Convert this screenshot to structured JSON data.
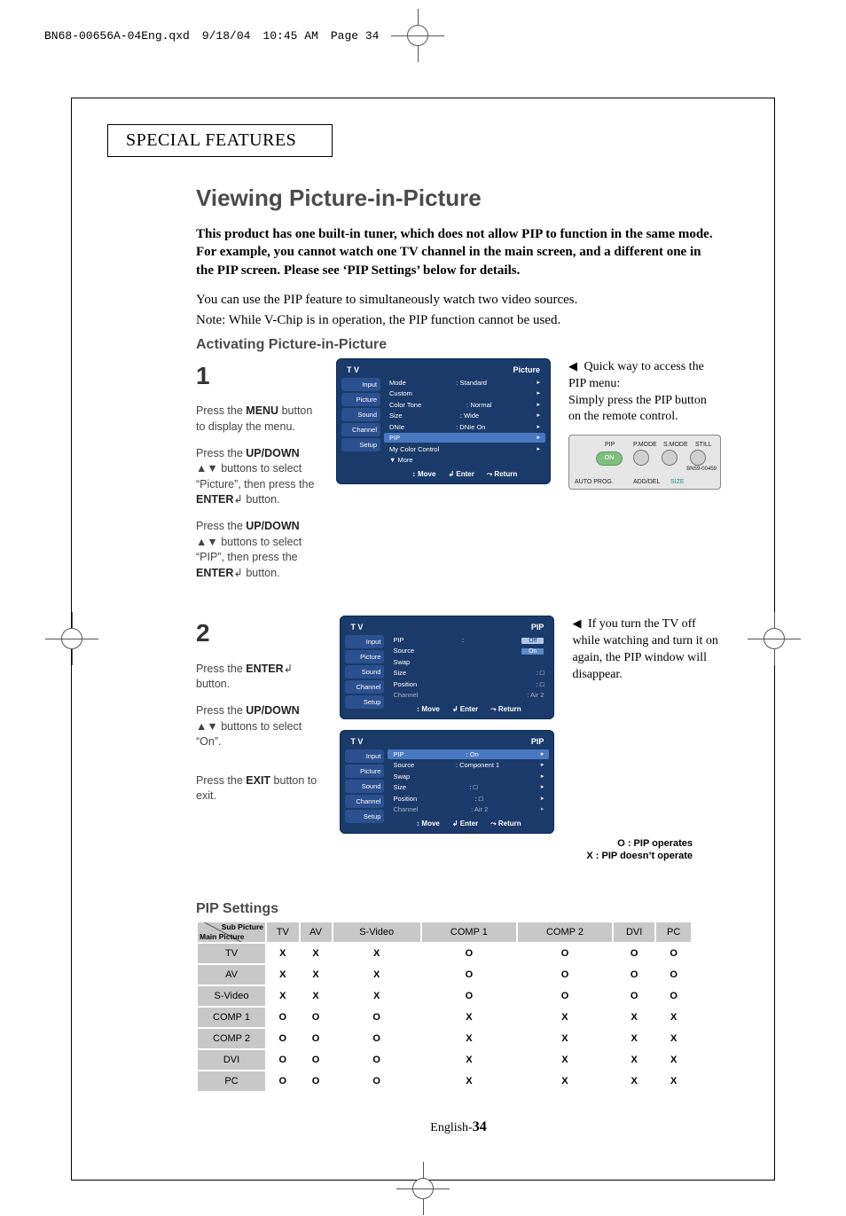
{
  "print_header": {
    "file": "BN68-00656A-04Eng.qxd",
    "date": "9/18/04",
    "time": "10:45 AM",
    "page_label": "Page 34"
  },
  "section_tab": "SPECIAL FEATURES",
  "title": "Viewing Picture-in-Picture",
  "lead": "This product has one built-in tuner, which does not allow PIP to function in the same mode. For example, you cannot watch one TV channel in the main screen, and a different one in the PIP screen. Please see ‘PIP Settings’ below for details.",
  "note1": "You can use the PIP feature to simultaneously watch two video sources.",
  "note2": "Note: While V-Chip is in operation, the PIP function cannot be used.",
  "sub_heading": "Activating Picture-in-Picture",
  "steps": {
    "s1": {
      "num": "1",
      "p1a": "Press the ",
      "p1b": "MENU",
      "p1c": " button to display the menu.",
      "p2a": "Press the ",
      "p2b": "UP/DOWN",
      "p2c": " ▲▼ buttons to select “Picture”, then press the ",
      "p2d": "ENTER",
      "p2e": "↲ button.",
      "p3a": "Press the ",
      "p3b": "UP/DOWN",
      "p3c": " ▲▼ buttons to select “PIP”, then press the ",
      "p3d": "ENTER",
      "p3e": "↲ button."
    },
    "s2": {
      "num": "2",
      "p1a": "Press the ",
      "p1b": "ENTER",
      "p1c": "↲ button.",
      "p2a": "Press the ",
      "p2b": "UP/DOWN",
      "p2c": " ▲▼ buttons to select “On”.",
      "p3a": "Press the ",
      "p3b": "EXIT",
      "p3c": " button to exit."
    }
  },
  "tip1": {
    "pointer": "◀",
    "l1": "Quick way to access the PIP menu:",
    "l2": "Simply press the PIP button on the remote control."
  },
  "tip2": {
    "pointer": "◀",
    "text": "If you turn the TV off while watching and turn it on again, the PIP window will disappear."
  },
  "remote": {
    "pip": "PIP",
    "on": "ON",
    "pmode": "P.MODE",
    "smode": "S.MODE",
    "still": "STILL",
    "model": "BN59-00459",
    "autoprog": "AUTO PROG.",
    "addel": "ADD/DEL",
    "size": "SIZE"
  },
  "osd": {
    "tv": "T V",
    "title_picture": "Picture",
    "title_pip": "PIP",
    "side": {
      "input": "Input",
      "picture": "Picture",
      "sound": "Sound",
      "channel": "Channel",
      "setup": "Setup"
    },
    "screen1": {
      "r1": {
        "k": "Mode",
        "v": "Standard"
      },
      "r2": {
        "k": "Custom",
        "v": ""
      },
      "r3": {
        "k": "Color Tone",
        "v": "Normal"
      },
      "r4": {
        "k": "Size",
        "v": "Wide"
      },
      "r5": {
        "k": "DNIe",
        "v": "DNIe On"
      },
      "r6": {
        "k": "PIP",
        "v": ""
      },
      "r7": {
        "k": "My Color Control",
        "v": ""
      },
      "more": "▼ More"
    },
    "screen2": {
      "r1": {
        "k": "PIP",
        "v_off": "Off",
        "v_on": "On"
      },
      "r2": {
        "k": "Source",
        "v": ""
      },
      "r3": {
        "k": "Swap",
        "v": ""
      },
      "r4": {
        "k": "Size",
        "v": "□"
      },
      "r5": {
        "k": "Position",
        "v": "□"
      },
      "r6": {
        "k": "Channel",
        "v": "Air    2"
      }
    },
    "screen3": {
      "r1": {
        "k": "PIP",
        "v": "On"
      },
      "r2": {
        "k": "Source",
        "v": "Component 1"
      },
      "r3": {
        "k": "Swap",
        "v": ""
      },
      "r4": {
        "k": "Size",
        "v": "□"
      },
      "r5": {
        "k": "Position",
        "v": "□"
      },
      "r6": {
        "k": "Channel",
        "v": "Air    2"
      }
    },
    "foot": {
      "move": "↕ Move",
      "enter": "↲ Enter",
      "ret": "⤳ Return"
    }
  },
  "settings": {
    "heading": "PIP Settings",
    "legend_o": "O : PIP operates",
    "legend_x": "X : PIP doesn’t operate",
    "corner_sub": "Sub Picture",
    "corner_main": "Main Picture",
    "cols": [
      "TV",
      "AV",
      "S-Video",
      "COMP 1",
      "COMP 2",
      "DVI",
      "PC"
    ],
    "rows": [
      {
        "h": "TV",
        "c": [
          "X",
          "X",
          "X",
          "O",
          "O",
          "O",
          "O"
        ]
      },
      {
        "h": "AV",
        "c": [
          "X",
          "X",
          "X",
          "O",
          "O",
          "O",
          "O"
        ]
      },
      {
        "h": "S-Video",
        "c": [
          "X",
          "X",
          "X",
          "O",
          "O",
          "O",
          "O"
        ]
      },
      {
        "h": "COMP 1",
        "c": [
          "O",
          "O",
          "O",
          "X",
          "X",
          "X",
          "X"
        ]
      },
      {
        "h": "COMP 2",
        "c": [
          "O",
          "O",
          "O",
          "X",
          "X",
          "X",
          "X"
        ]
      },
      {
        "h": "DVI",
        "c": [
          "O",
          "O",
          "O",
          "X",
          "X",
          "X",
          "X"
        ]
      },
      {
        "h": "PC",
        "c": [
          "O",
          "O",
          "O",
          "X",
          "X",
          "X",
          "X"
        ]
      }
    ]
  },
  "page_foot": {
    "lang": "English-",
    "num": "34"
  }
}
